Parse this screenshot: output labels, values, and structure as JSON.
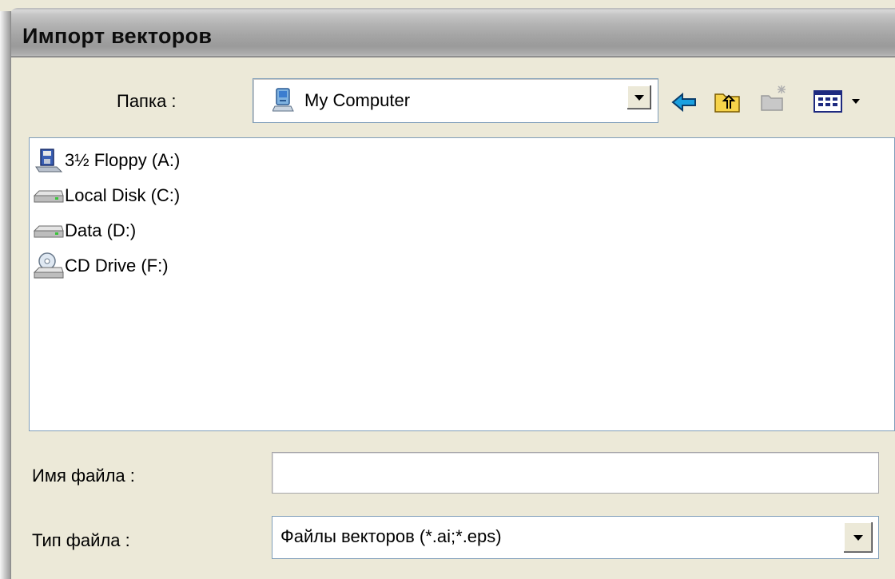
{
  "window": {
    "title": "Импорт векторов"
  },
  "look_in": {
    "label": "Папка :",
    "value": "My Computer",
    "icon": "my-computer-icon"
  },
  "toolbar": {
    "buttons": [
      {
        "name": "back",
        "icon": "back-arrow-icon"
      },
      {
        "name": "up-one-level",
        "icon": "up-folder-icon"
      },
      {
        "name": "create-new-folder",
        "icon": "new-folder-icon"
      },
      {
        "name": "view-menu",
        "icon": "view-menu-icon"
      }
    ]
  },
  "file_list": {
    "items": [
      {
        "label": "3½ Floppy (A:)",
        "icon": "floppy-drive-icon"
      },
      {
        "label": "Local Disk (C:)",
        "icon": "hard-disk-icon"
      },
      {
        "label": "Data (D:)",
        "icon": "hard-disk-icon"
      },
      {
        "label": "CD Drive (F:)",
        "icon": "cd-drive-icon"
      }
    ]
  },
  "file_name": {
    "label": "Имя файла :",
    "value": ""
  },
  "file_type": {
    "label": "Тип файла :",
    "value": "Файлы векторов (*.ai;*.eps)"
  },
  "colors": {
    "dialog_bg": "#ece9d8",
    "field_border": "#7f9db9",
    "back_arrow": "#1aa0e0"
  }
}
